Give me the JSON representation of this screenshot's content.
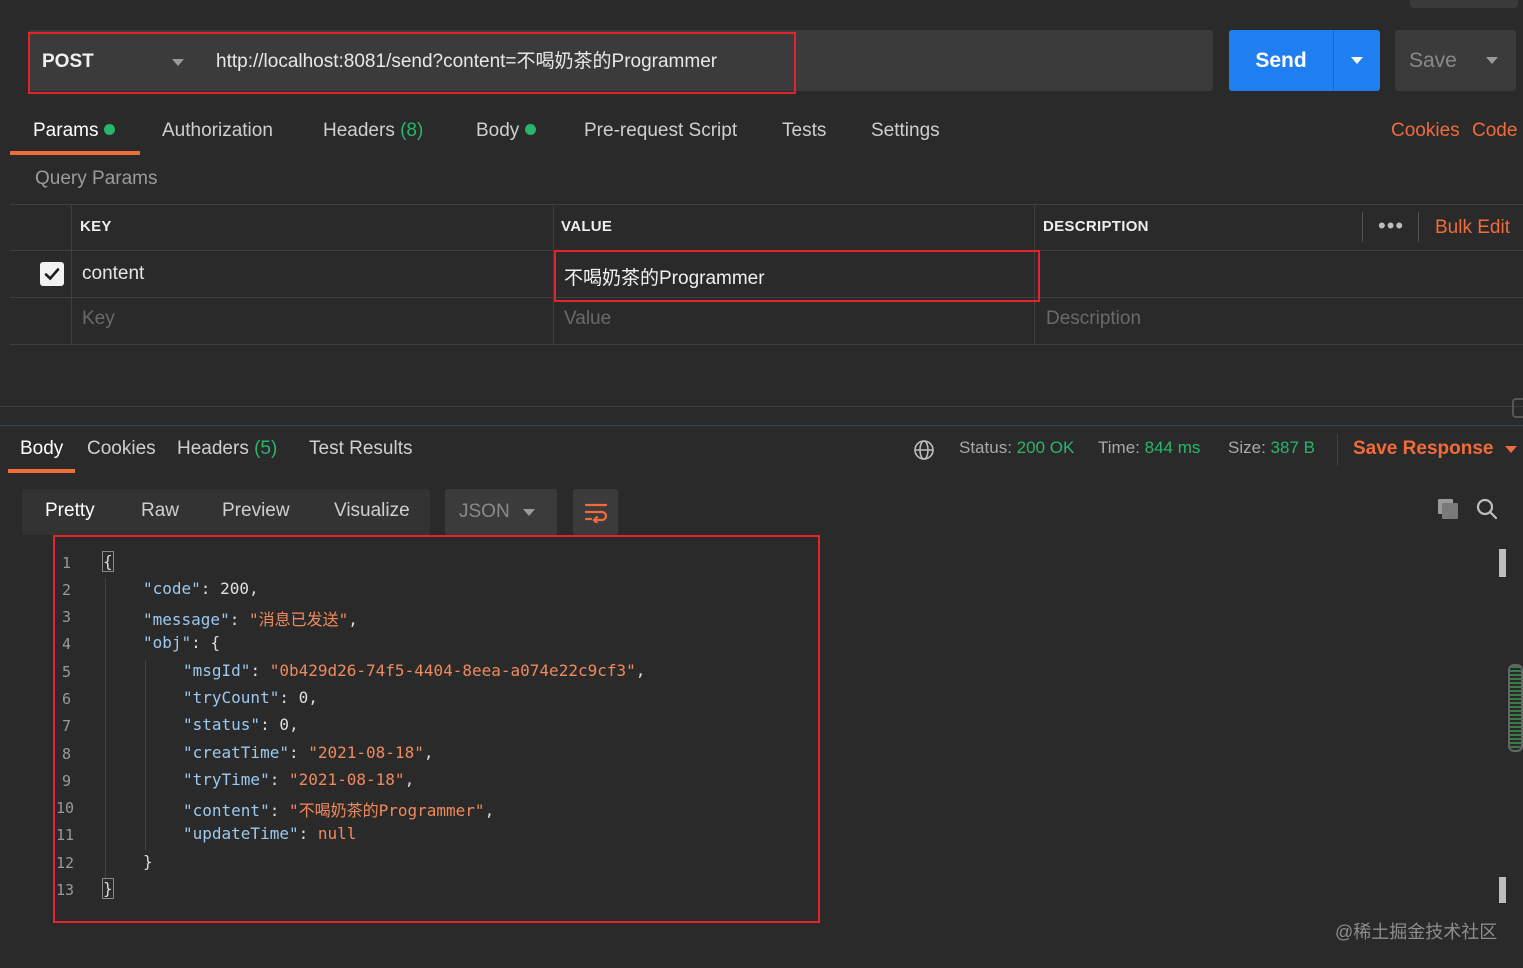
{
  "request": {
    "method": "POST",
    "url": "http://localhost:8081/send?content=不喝奶茶的Programmer",
    "send_label": "Send",
    "save_label": "Save"
  },
  "request_tabs": [
    {
      "label": "Params"
    },
    {
      "label": "Authorization"
    },
    {
      "label": "Headers",
      "count": "(8)"
    },
    {
      "label": "Body"
    },
    {
      "label": "Pre-request Script"
    },
    {
      "label": "Tests"
    },
    {
      "label": "Settings"
    }
  ],
  "right_links": {
    "cookies": "Cookies",
    "code": "Code"
  },
  "query_params": {
    "title": "Query Params",
    "headers": {
      "key": "KEY",
      "value": "VALUE",
      "description": "DESCRIPTION",
      "bulk_edit": "Bulk Edit"
    },
    "rows": [
      {
        "checked": true,
        "key": "content",
        "value": "不喝奶茶的Programmer",
        "description": ""
      }
    ],
    "placeholders": {
      "key": "Key",
      "value": "Value",
      "description": "Description"
    }
  },
  "response": {
    "tabs": [
      {
        "label": "Body"
      },
      {
        "label": "Cookies"
      },
      {
        "label": "Headers",
        "count": "(5)"
      },
      {
        "label": "Test Results"
      }
    ],
    "status_label": "Status:",
    "status": "200 OK",
    "time_label": "Time:",
    "time": "844 ms",
    "size_label": "Size:",
    "size": "387 B",
    "save_response": "Save Response",
    "views": [
      "Pretty",
      "Raw",
      "Preview",
      "Visualize"
    ],
    "format": "JSON",
    "line_numbers": [
      "1",
      "2",
      "3",
      "4",
      "5",
      "6",
      "7",
      "8",
      "9",
      "10",
      "11",
      "12",
      "13"
    ],
    "body": {
      "open_brace": "{",
      "code_key": "\"code\"",
      "code_val": "200",
      "message_key": "\"message\"",
      "message_val": "\"消息已发送\"",
      "obj_key": "\"obj\"",
      "msgId_key": "\"msgId\"",
      "msgId_val": "\"0b429d26-74f5-4404-8eea-a074e22c9cf3\"",
      "tryCount_key": "\"tryCount\"",
      "tryCount_val": "0",
      "status_key": "\"status\"",
      "status_val": "0",
      "creatTime_key": "\"creatTime\"",
      "creatTime_val": "\"2021-08-18\"",
      "tryTime_key": "\"tryTime\"",
      "tryTime_val": "\"2021-08-18\"",
      "content_key": "\"content\"",
      "content_val": "\"不喝奶茶的Programmer\"",
      "updateTime_key": "\"updateTime\"",
      "updateTime_val": "null",
      "inner_close": "}",
      "close_brace": "}"
    }
  },
  "watermark": "@稀土掘金技术社区",
  "colors": {
    "accent": "#f26b3a",
    "send": "#1f7ef0",
    "ok": "#27b66c",
    "highlight": "#e3242b"
  }
}
